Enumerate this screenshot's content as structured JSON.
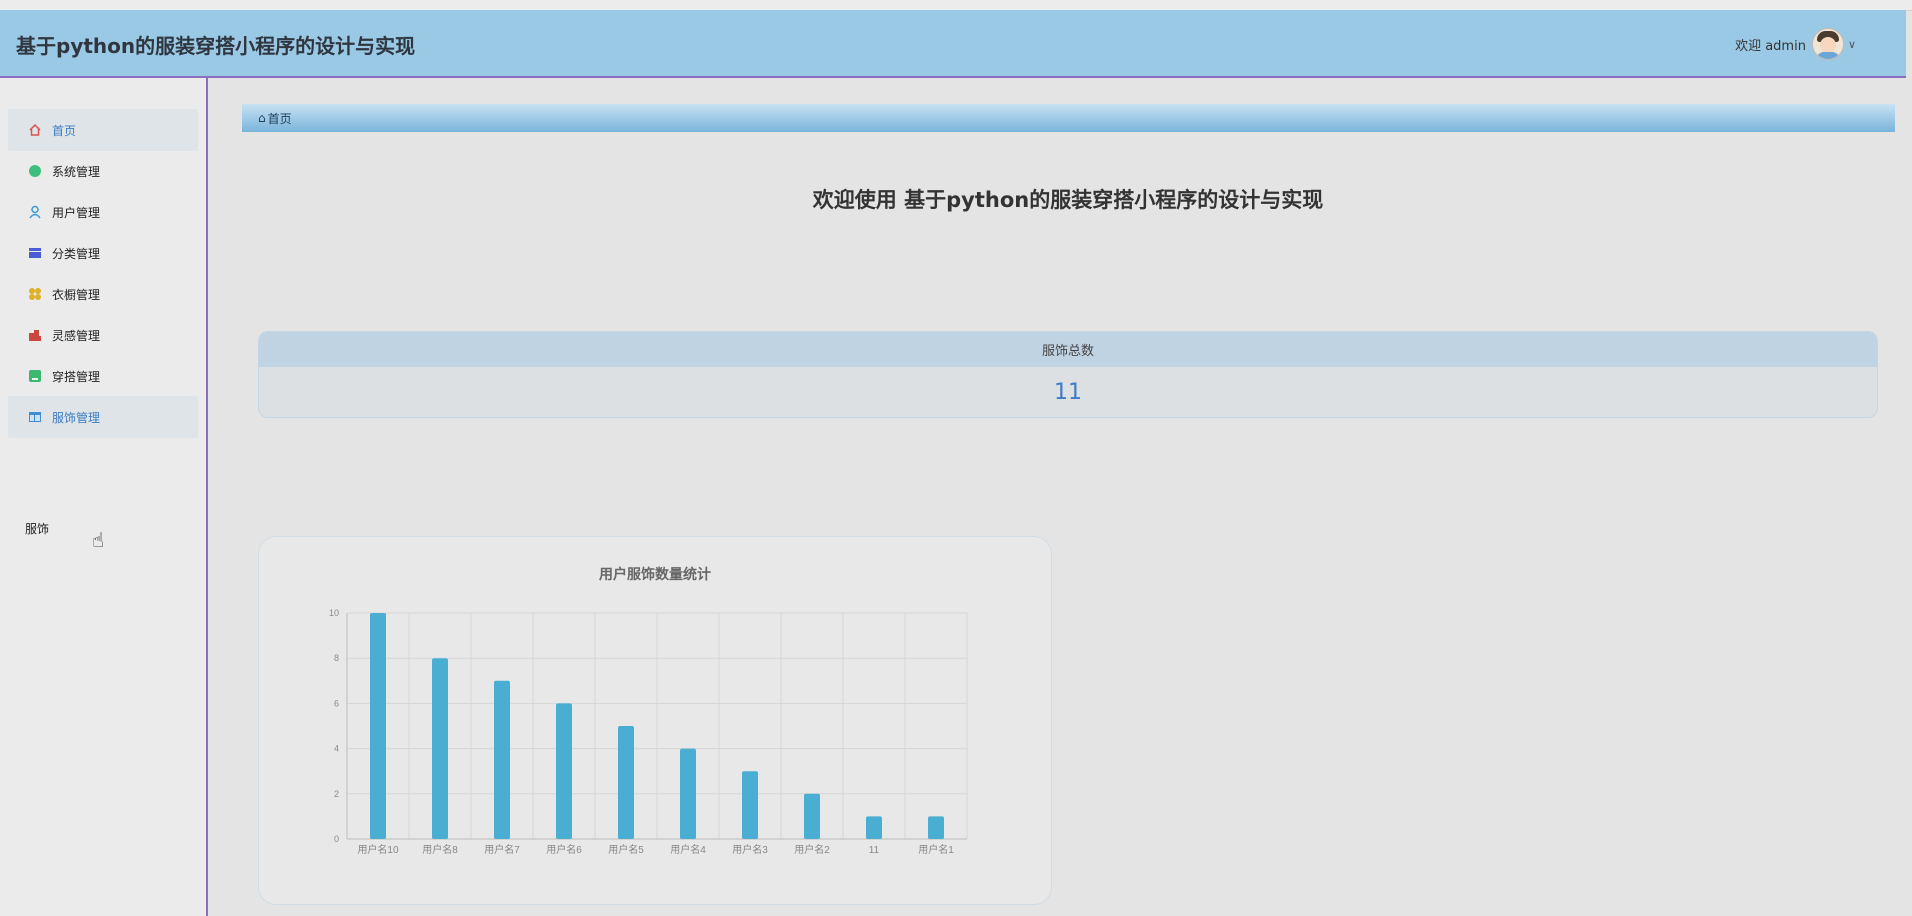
{
  "header": {
    "title": "基于python的服装穿搭小程序的设计与实现",
    "welcome": "欢迎 admin",
    "dropdown_icon": "chevron-down-icon"
  },
  "sidebar": {
    "items": [
      {
        "label": "首页",
        "icon": "home-icon",
        "color": "#d9534f"
      },
      {
        "label": "系统管理",
        "icon": "circle-icon",
        "color": "#3fbf7f"
      },
      {
        "label": "用户管理",
        "icon": "user-icon",
        "color": "#3a9ad9"
      },
      {
        "label": "分类管理",
        "icon": "category-icon",
        "color": "#4a5bd6"
      },
      {
        "label": "衣橱管理",
        "icon": "wardrobe-icon",
        "color": "#e0b02a"
      },
      {
        "label": "灵感管理",
        "icon": "inspiration-icon",
        "color": "#c9473f"
      },
      {
        "label": "穿搭管理",
        "icon": "outfit-icon",
        "color": "#3cb96e"
      },
      {
        "label": "服饰管理",
        "icon": "clothing-icon",
        "color": "#3a8fd6"
      }
    ],
    "submenu": [
      "服饰"
    ]
  },
  "breadcrumb": {
    "items": [
      "首页"
    ]
  },
  "main": {
    "welcome_title": "欢迎使用 基于python的服装穿搭小程序的设计与实现",
    "stat": {
      "label": "服饰总数",
      "value": "11"
    }
  },
  "chart_data": {
    "type": "bar",
    "title": "用户服饰数量统计",
    "categories": [
      "用户名10",
      "用户名8",
      "用户名7",
      "用户名6",
      "用户名5",
      "用户名4",
      "用户名3",
      "用户名2",
      "11",
      "用户名1"
    ],
    "values": [
      10,
      8,
      7,
      6,
      5,
      4,
      3,
      2,
      1,
      1
    ],
    "ylim": [
      0,
      10
    ],
    "yticks": [
      0,
      2,
      4,
      6,
      8,
      10
    ],
    "grid": true,
    "bar_color": "#4aaed3"
  }
}
